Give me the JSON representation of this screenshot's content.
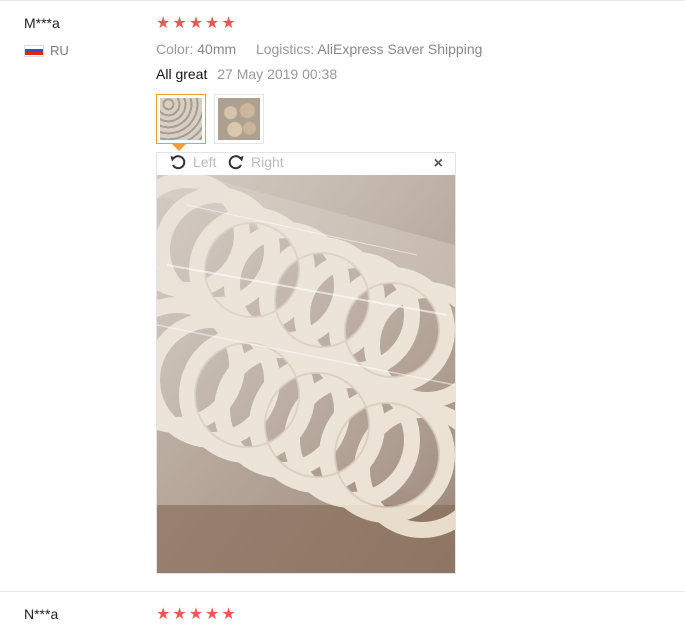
{
  "review1": {
    "user": "M***a",
    "country": "RU",
    "rating": 5,
    "color_label": "Color:",
    "color_value": "40mm",
    "logistics_label": "Logistics:",
    "logistics_value": "AliExpress Saver Shipping",
    "feedback": "All great",
    "date": "27 May 2019 00:38",
    "viewer": {
      "rotate_left": "Left",
      "rotate_right": "Right",
      "close": "×"
    }
  },
  "review2": {
    "user": "N***a",
    "rating": 5
  },
  "colors": {
    "star": "#e85a5a",
    "thumb_active_border": "#f39b3a",
    "divider": "#e6e6e6"
  },
  "icons": {
    "star": "★",
    "rotate_left": "rotate-left-icon",
    "rotate_right": "rotate-right-icon",
    "close": "close-icon"
  }
}
